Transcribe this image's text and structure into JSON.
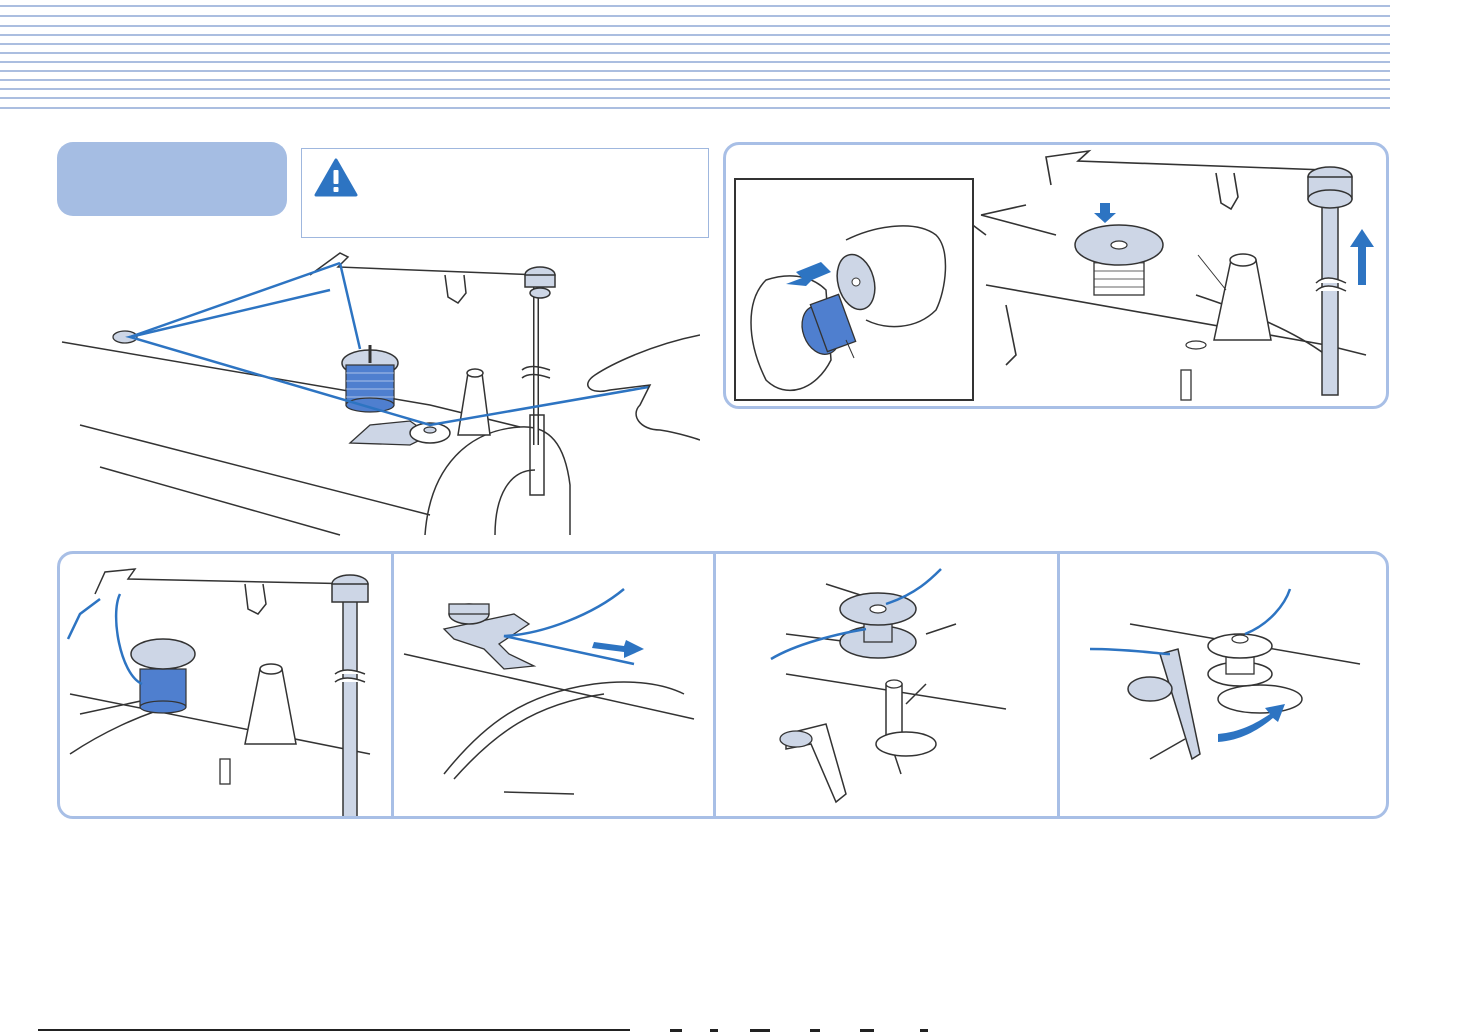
{
  "page": {
    "header_text": "",
    "section_tab_label": "",
    "warning_text": "",
    "footer_text": ""
  },
  "colors": {
    "header_stripe": "#8fa9d6",
    "panel_border": "#a8bfe6",
    "section_tab": "#a5bde3",
    "thread_blue": "#2d74c2",
    "spool_blue": "#4f7fcf",
    "line_art": "#333333",
    "part_fill": "#cdd6e6"
  },
  "icons": {
    "warning": "warning-triangle-icon",
    "arrow": "direction-arrow-icon"
  }
}
